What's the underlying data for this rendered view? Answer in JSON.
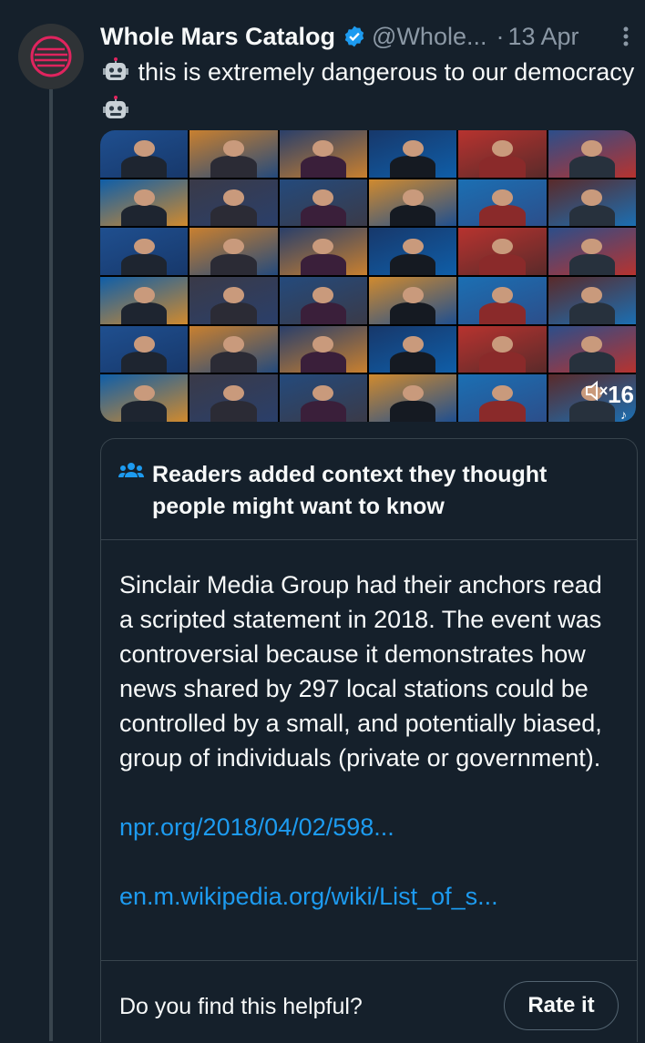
{
  "author": {
    "name": "Whole Mars Catalog",
    "handle": "@Whole...",
    "separator": "·",
    "date": "13 Apr"
  },
  "tweet": {
    "text": "this is extremely dangerous to our democracy",
    "emoji": "robot-face-icon"
  },
  "media": {
    "overlay_number": "16",
    "watermark": "♪"
  },
  "community_note": {
    "title": "Readers added context they thought people might want to know",
    "body": "Sinclair Media Group had their anchors read a scripted statement in 2018. The event was controversial because it demonstrates how news shared by 297 local stations could be controlled by a small, and potentially biased, group of individuals (private or government).",
    "link1": "npr.org/2018/04/02/598...",
    "link2": "en.m.wikipedia.org/wiki/List_of_s...",
    "helpful_prompt": "Do you find this helpful?",
    "rate_button": "Rate it"
  },
  "colors": {
    "background": "#15202b",
    "link": "#1d9bf0",
    "verified": "#1d9bf0",
    "muted_text": "#8b98a5",
    "border": "#38444d"
  }
}
